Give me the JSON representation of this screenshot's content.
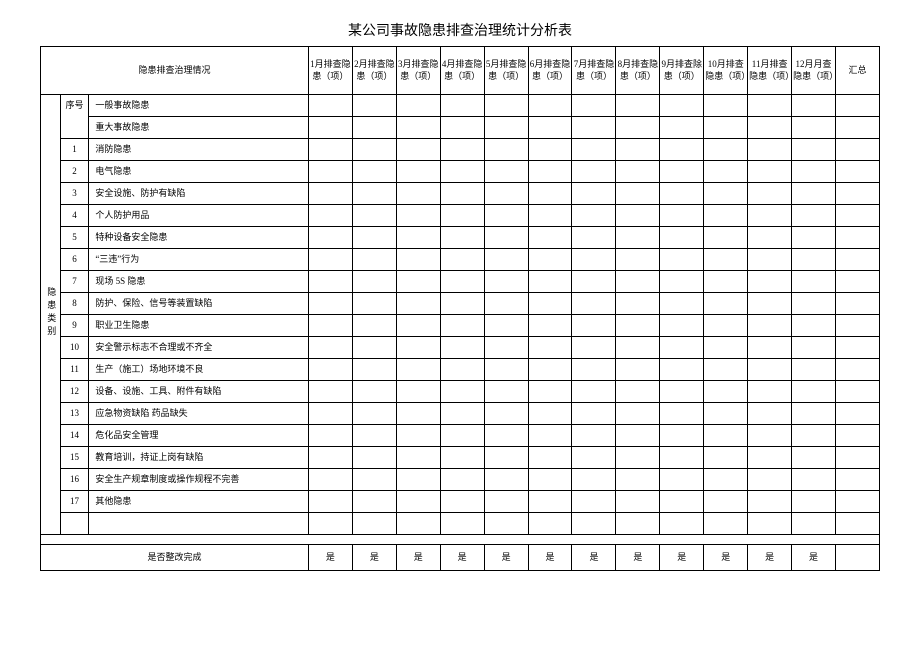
{
  "title": "某公司事故隐患排查治理统计分析表",
  "header": {
    "situation": "隐患排查治理情况",
    "months": [
      "1月排查隐患（项）",
      "2月排查隐患（项）",
      "3月排查隐患（项）",
      "4月排查隐患（项）",
      "5月排查隐患（项）",
      "6月排查隐患（项）",
      "7月排查隐患（项）",
      "8月排查隐患（项）",
      "9月排查除患（项）",
      "10月排查隐患（项）",
      "11月排查隐患（项）",
      "12月月查隐患（项）"
    ],
    "total": "汇总"
  },
  "group_label": "隐患类别",
  "seq_header": "序号",
  "rows": [
    {
      "seq": "",
      "item": "一般事故隐患"
    },
    {
      "seq": "",
      "item": "重大事故隐患"
    },
    {
      "seq": "1",
      "item": "消防隐患"
    },
    {
      "seq": "2",
      "item": "电气隐患"
    },
    {
      "seq": "3",
      "item": "安全设施、防护有缺陷"
    },
    {
      "seq": "4",
      "item": "个人防护用品"
    },
    {
      "seq": "5",
      "item": "特种设备安全隐患"
    },
    {
      "seq": "6",
      "item": "“三违”行为"
    },
    {
      "seq": "7",
      "item": "现场 5S 隐患"
    },
    {
      "seq": "8",
      "item": "防护、保险、信号等装置缺陷"
    },
    {
      "seq": "9",
      "item": "职业卫生隐患"
    },
    {
      "seq": "10",
      "item": "安全警示标志不合理或不齐全"
    },
    {
      "seq": "11",
      "item": "生产（施工）场地环境不良"
    },
    {
      "seq": "12",
      "item": "设备、设施、工具、附件有缺陷"
    },
    {
      "seq": "13",
      "item": "应急物资缺陷 药品缺失"
    },
    {
      "seq": "14",
      "item": "危化品安全管理"
    },
    {
      "seq": "15",
      "item": "教育培训，持证上岗有缺陷"
    },
    {
      "seq": "16",
      "item": "安全生产规章制度或操作规程不完善"
    },
    {
      "seq": "17",
      "item": "其他隐患"
    }
  ],
  "summary_label": "是否整改完成",
  "summary_value": "是"
}
